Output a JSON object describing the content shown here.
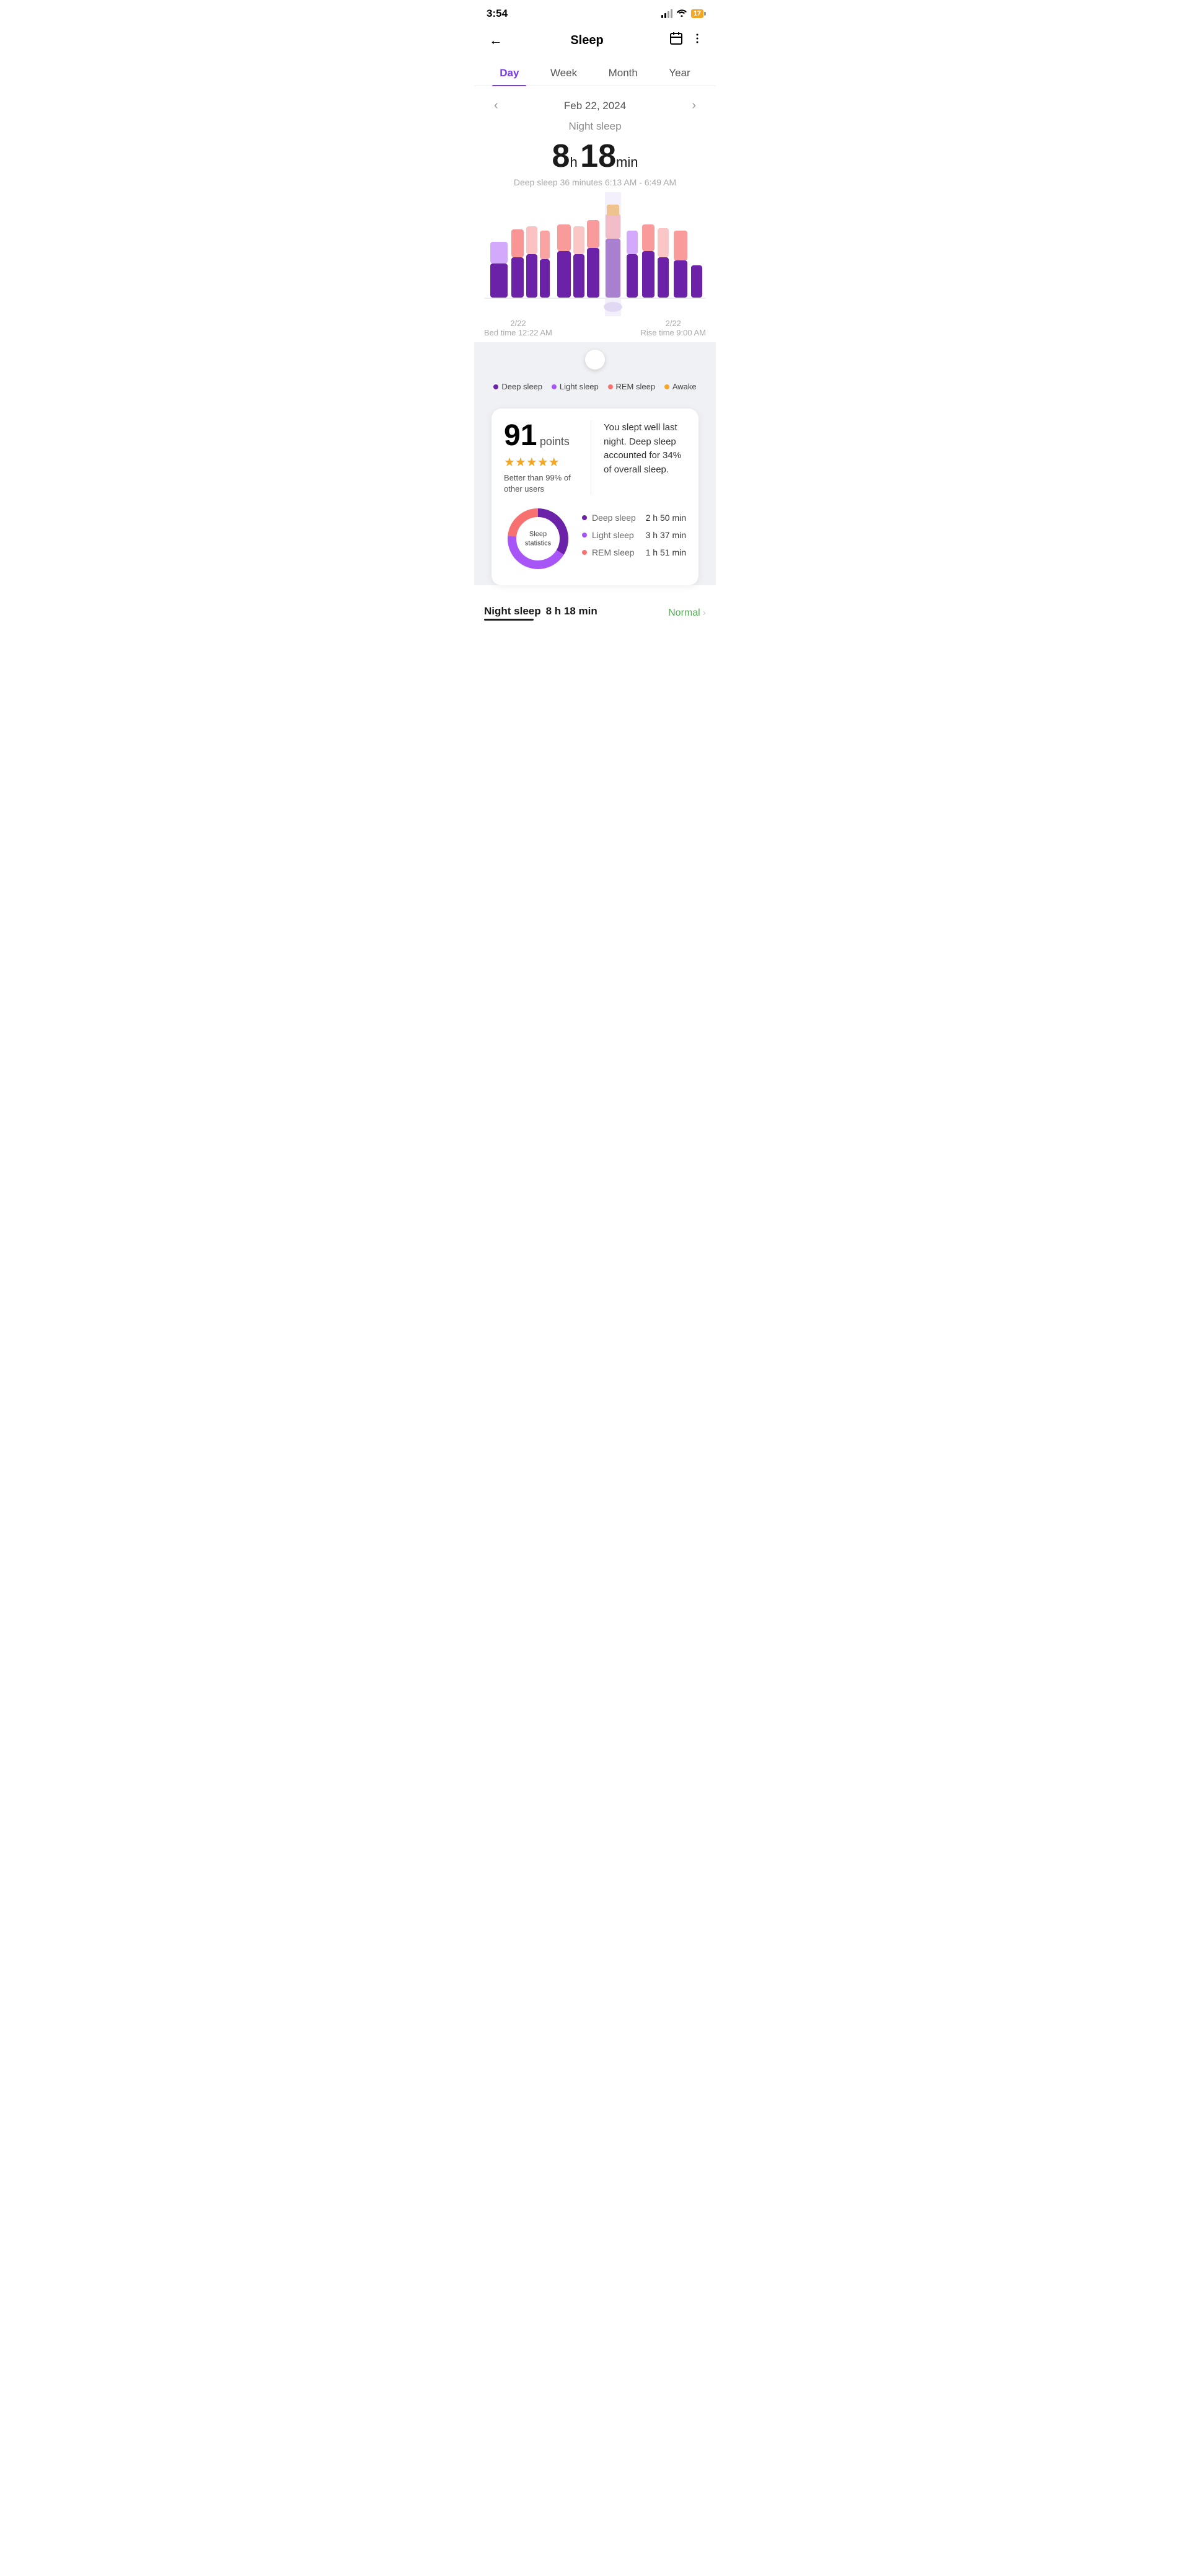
{
  "statusBar": {
    "time": "3:54",
    "battery": "17",
    "batteryColor": "#f5a623"
  },
  "header": {
    "title": "Sleep",
    "backLabel": "←"
  },
  "tabs": {
    "items": [
      "Day",
      "Week",
      "Month",
      "Year"
    ],
    "activeIndex": 0
  },
  "dateNav": {
    "date": "Feb 22, 2024",
    "prevArrow": "‹",
    "nextArrow": "›"
  },
  "sleepSummary": {
    "label": "Night sleep",
    "hours": "8",
    "hUnit": "h",
    "minutes": "18",
    "mUnit": "min",
    "deepSleepDetail": "Deep sleep 36 minutes 6:13 AM - 6:49 AM"
  },
  "chartFooter": {
    "left": {
      "date": "2/22",
      "time": "Bed time 12:22 AM"
    },
    "right": {
      "date": "2/22",
      "time": "Rise time 9:00 AM"
    }
  },
  "legend": [
    {
      "label": "Deep sleep",
      "color": "#6b21a8"
    },
    {
      "label": "Light sleep",
      "color": "#a855f7"
    },
    {
      "label": "REM sleep",
      "color": "#f87171"
    },
    {
      "label": "Awake",
      "color": "#f5a623"
    }
  ],
  "scoreCard": {
    "points": "91",
    "pointsLabel": "points",
    "stars": "★★★★★",
    "rank": "Better than 99% of\nother users",
    "description": "You slept well last night. Deep sleep accounted for 34% of overall sleep."
  },
  "sleepStats": {
    "donutLabel": "Sleep\nstatistics",
    "items": [
      {
        "label": "Deep sleep",
        "color": "#6b21a8",
        "value": "2 h 50 min"
      },
      {
        "label": "Light sleep",
        "color": "#a855f7",
        "value": "3 h 37 min"
      },
      {
        "label": "REM sleep",
        "color": "#f87171",
        "value": "1 h 51 min"
      }
    ]
  },
  "nightSleepRow": {
    "title": "Night sleep",
    "value": "8 h 18 min",
    "normalLabel": "Normal",
    "chevron": "›"
  }
}
